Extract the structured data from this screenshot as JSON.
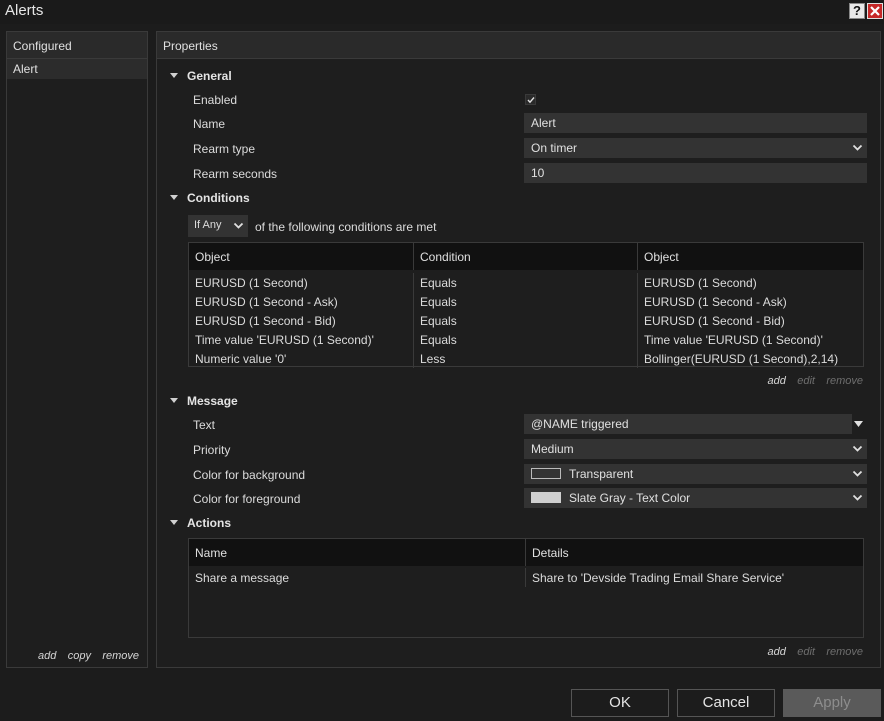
{
  "window": {
    "title": "Alerts",
    "help_glyph": "?"
  },
  "configured": {
    "header": "Configured",
    "items": [
      "Alert"
    ],
    "actions": {
      "add": "add",
      "copy": "copy",
      "remove": "remove"
    }
  },
  "properties": {
    "header": "Properties",
    "general": {
      "label": "General",
      "enabled_label": "Enabled",
      "enabled": true,
      "name_label": "Name",
      "name_value": "Alert",
      "rearm_type_label": "Rearm type",
      "rearm_type_value": "On timer",
      "rearm_seconds_label": "Rearm seconds",
      "rearm_seconds_value": "10"
    },
    "conditions": {
      "label": "Conditions",
      "mode": "If Any",
      "mode_suffix": "of the following conditions are met",
      "columns": [
        "Object",
        "Condition",
        "Object"
      ],
      "rows": [
        [
          "EURUSD (1 Second)",
          "Equals",
          "EURUSD (1 Second)"
        ],
        [
          "EURUSD (1 Second - Ask)",
          "Equals",
          "EURUSD (1 Second - Ask)"
        ],
        [
          "EURUSD (1 Second - Bid)",
          "Equals",
          "EURUSD (1 Second - Bid)"
        ],
        [
          "Time value 'EURUSD (1 Second)'",
          "Equals",
          "Time value 'EURUSD (1 Second)'"
        ],
        [
          "Numeric value '0'",
          "Less",
          "Bollinger(EURUSD (1 Second),2,14)"
        ]
      ],
      "actions": {
        "add": "add",
        "edit": "edit",
        "remove": "remove"
      }
    },
    "message": {
      "label": "Message",
      "text_label": "Text",
      "text_value": "@NAME triggered",
      "priority_label": "Priority",
      "priority_value": "Medium",
      "bg_label": "Color for background",
      "bg_value": "Transparent",
      "bg_color": "transparent",
      "fg_label": "Color for foreground",
      "fg_value": "Slate Gray - Text Color",
      "fg_color": "#d0d0d0"
    },
    "actions": {
      "label": "Actions",
      "columns": [
        "Name",
        "Details"
      ],
      "rows": [
        [
          "Share a message",
          "Share to 'Devside Trading Email Share Service'"
        ]
      ],
      "actions": {
        "add": "add",
        "edit": "edit",
        "remove": "remove"
      }
    }
  },
  "buttons": {
    "ok": "OK",
    "cancel": "Cancel",
    "apply": "Apply"
  }
}
